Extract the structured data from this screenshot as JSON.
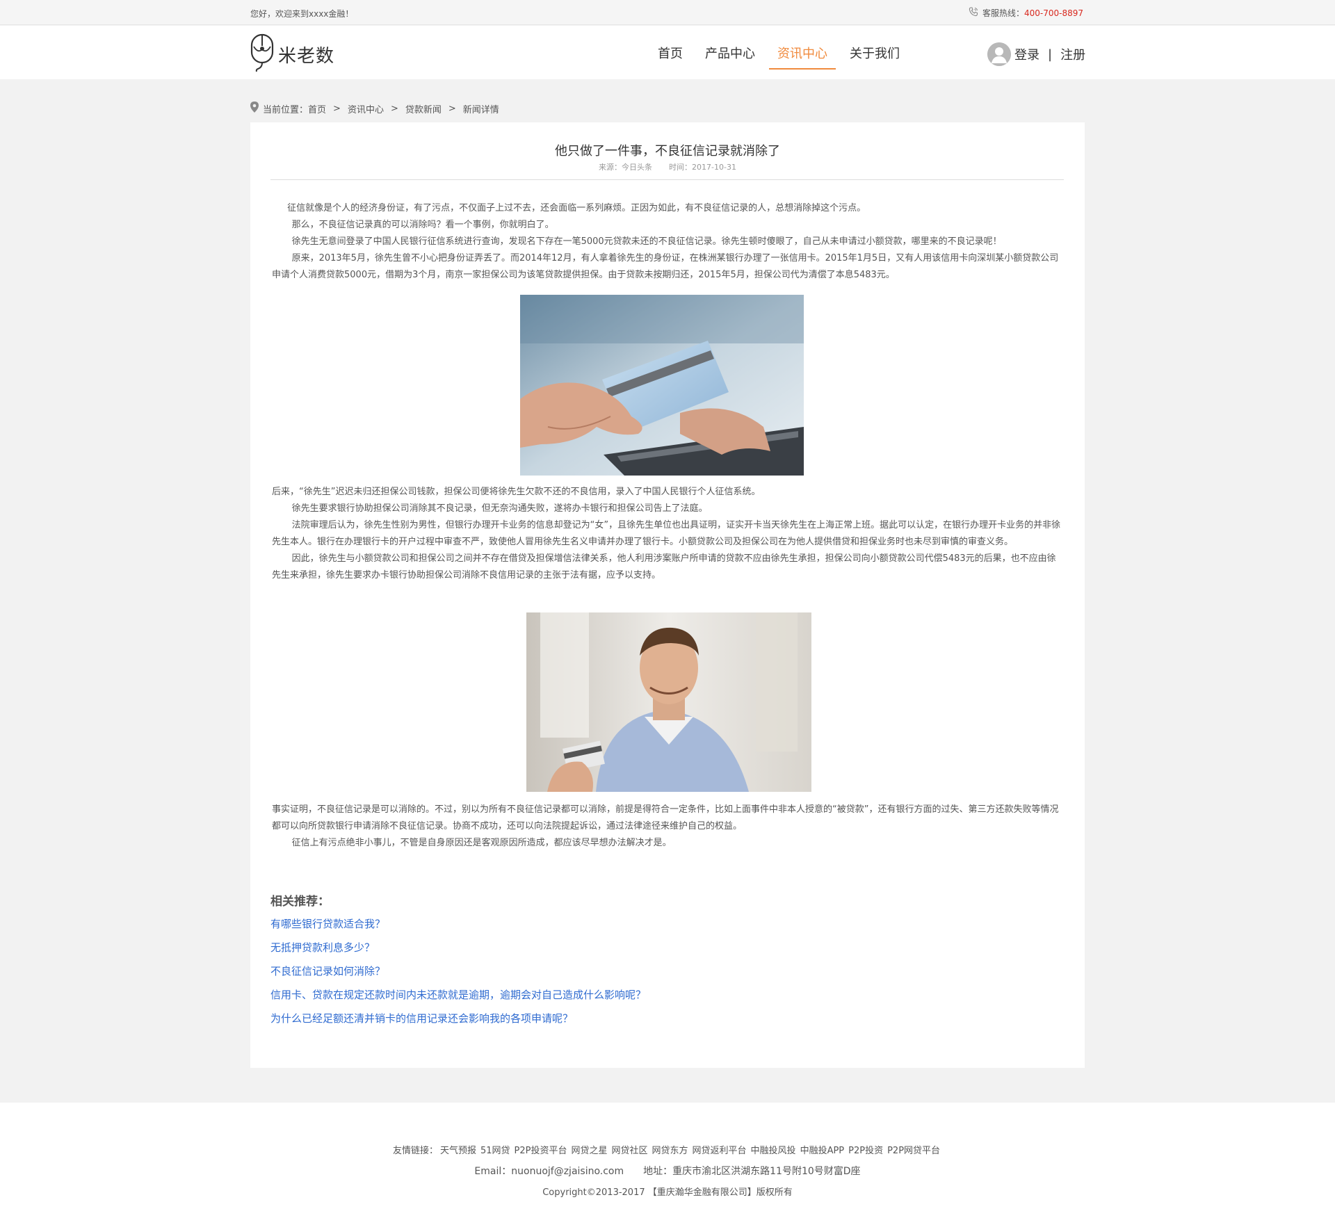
{
  "topbar": {
    "welcome": "您好，欢迎来到xxxx金融！",
    "hotline_label": "客服热线：",
    "hotline_number": "400-700-8897"
  },
  "header": {
    "logo_text": "米老数",
    "nav": [
      {
        "label": "首页",
        "active": false
      },
      {
        "label": "产品中心",
        "active": false
      },
      {
        "label": "资讯中心",
        "active": true
      },
      {
        "label": "关于我们",
        "active": false
      }
    ],
    "login": "登录",
    "separator": "|",
    "register": "注册",
    "accent_color": "#f08a3c"
  },
  "breadcrumb": {
    "prefix": "当前位置：",
    "items": [
      "首页",
      "资讯中心",
      "贷款新闻",
      "新闻详情"
    ],
    "separator": ">"
  },
  "article": {
    "title": "他只做了一件事，不良征信记录就消除了",
    "source": "来源：今日头条",
    "time": "时间：2017-10-31",
    "paragraphs_1": [
      "征信就像是个人的经济身份证，有了污点，不仅面子上过不去，还会面临一系列麻烦。正因为如此，有不良征信记录的人，总想消除掉这个污点。",
      "那么，不良征信记录真的可以消除吗？看一个事例，你就明白了。",
      "徐先生无意间登录了中国人民银行征信系统进行查询，发现名下存在一笔5000元贷款未还的不良征信记录。徐先生顿时傻眼了，自己从未申请过小额贷款，哪里来的不良记录呢！",
      "原来，2013年5月，徐先生曾不小心把身份证弄丢了。而2014年12月，有人拿着徐先生的身份证，在株洲某银行办理了一张信用卡。2015年1月5日，又有人用该信用卡向深圳某小额贷款公司申请个人消费贷款5000元，借期为3个月，南京一家担保公司为该笔贷款提供担保。由于贷款未按期归还，2015年5月，担保公司代为清偿了本息5483元。"
    ],
    "paragraphs_2": [
      "后来，“徐先生”迟迟未归还担保公司钱款，担保公司便将徐先生欠款不还的不良信用，录入了中国人民银行个人征信系统。",
      "徐先生要求银行协助担保公司消除其不良记录，但无奈沟通失败，遂将办卡银行和担保公司告上了法庭。",
      "法院审理后认为，徐先生性别为男性，但银行办理开卡业务的信息却登记为“女”，且徐先生单位也出具证明，证实开卡当天徐先生在上海正常上班。据此可以认定，在银行办理开卡业务的并非徐先生本人。银行在办理银行卡的开户过程中审查不严，致使他人冒用徐先生名义申请并办理了银行卡。小额贷款公司及担保公司在为他人提供借贷和担保业务时也未尽到审慎的审查义务。",
      "因此，徐先生与小额贷款公司和担保公司之间并不存在借贷及担保增信法律关系，他人利用涉案账户所申请的贷款不应由徐先生承担，担保公司向小额贷款公司代偿5483元的后果，也不应由徐先生来承担，徐先生要求办卡银行协助担保公司消除不良信用记录的主张于法有据，应予以支持。"
    ],
    "paragraphs_3": [
      "事实证明，不良征信记录是可以消除的。不过，别以为所有不良征信记录都可以消除，前提是得符合一定条件，比如上面事件中非本人授意的“被贷款”，还有银行方面的过失、第三方还款失败等情况都可以向所贷款银行申请消除不良征信记录。协商不成功，还可以向法院提起诉讼，通过法律途径来维护自己的权益。",
      "征信上有污点绝非小事儿，不管是自身原因还是客观原因所造成，都应该尽早想办法解决才是。"
    ]
  },
  "related": {
    "title": "相关推荐：",
    "items": [
      "有哪些银行贷款适合我？",
      "无抵押贷款利息多少？",
      "不良征信记录如何消除？",
      "信用卡、贷款在规定还款时间内未还款就是逾期，逾期会对自己造成什么影响呢？",
      "为什么已经足额还清并销卡的信用记录还会影响我的各项申请呢？"
    ],
    "link_color": "#2f6bd0"
  },
  "footer": {
    "links_label": "友情链接：",
    "links": [
      "天气预报",
      "51网贷",
      "P2P投资平台",
      "网贷之星",
      "网贷社区",
      "网贷东方",
      "网贷返利平台",
      "中融投风投",
      "中融投APP",
      "P2P投资",
      "P2P网贷平台"
    ],
    "email": "Email：nuonuojf@zjaisino.com",
    "address": "地址：重庆市渝北区洪湖东路11号附10号财富D座",
    "copyright": "Copyright©2013-2017 【重庆瀚华金融有限公司】版权所有"
  }
}
